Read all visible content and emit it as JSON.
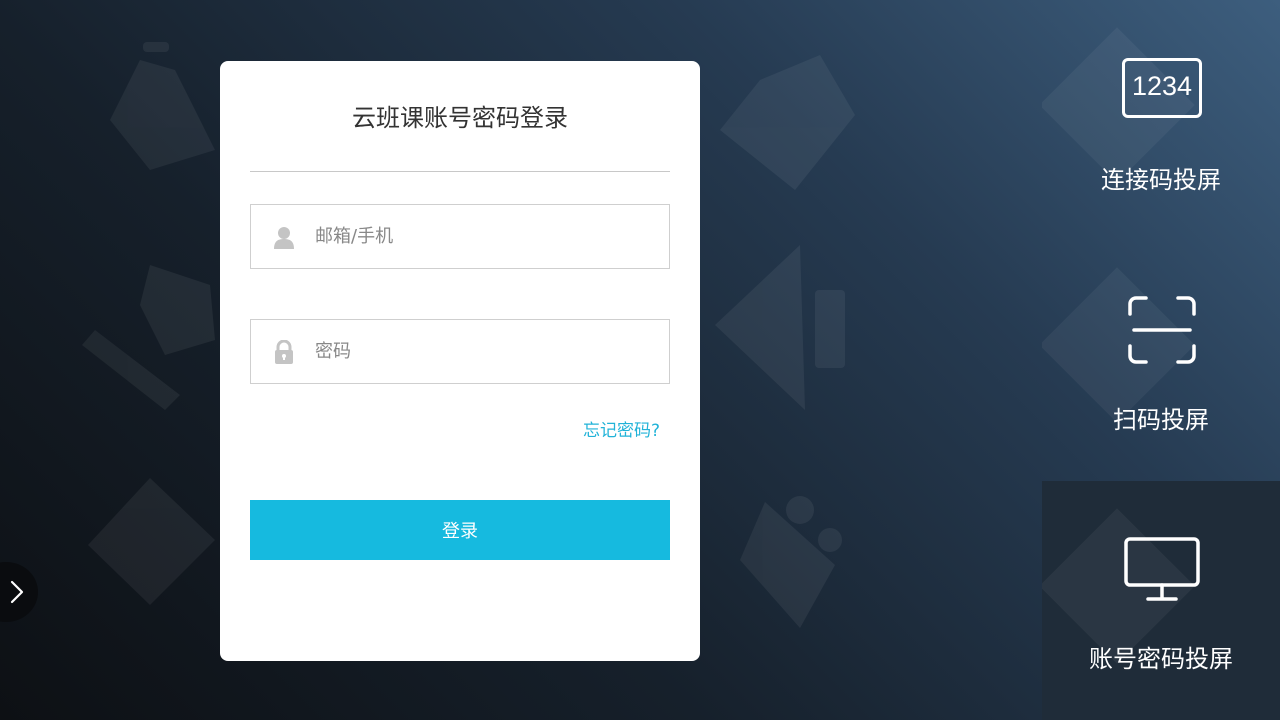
{
  "login_card": {
    "title": "云班课账号密码登录",
    "account_placeholder": "邮箱/手机",
    "password_placeholder": "密码",
    "forgot_link": "忘记密码?",
    "submit_label": "登录",
    "accent_color": "#16badf"
  },
  "right_panel": {
    "items": [
      {
        "icon": "code-box-icon",
        "icon_text": "1234",
        "label": "连接码投屏",
        "active": false
      },
      {
        "icon": "scan-icon",
        "label": "扫码投屏",
        "active": false
      },
      {
        "icon": "monitor-icon",
        "label": "账号密码投屏",
        "active": true
      }
    ]
  },
  "side_toggle": {
    "icon": "chevron-right-icon"
  }
}
